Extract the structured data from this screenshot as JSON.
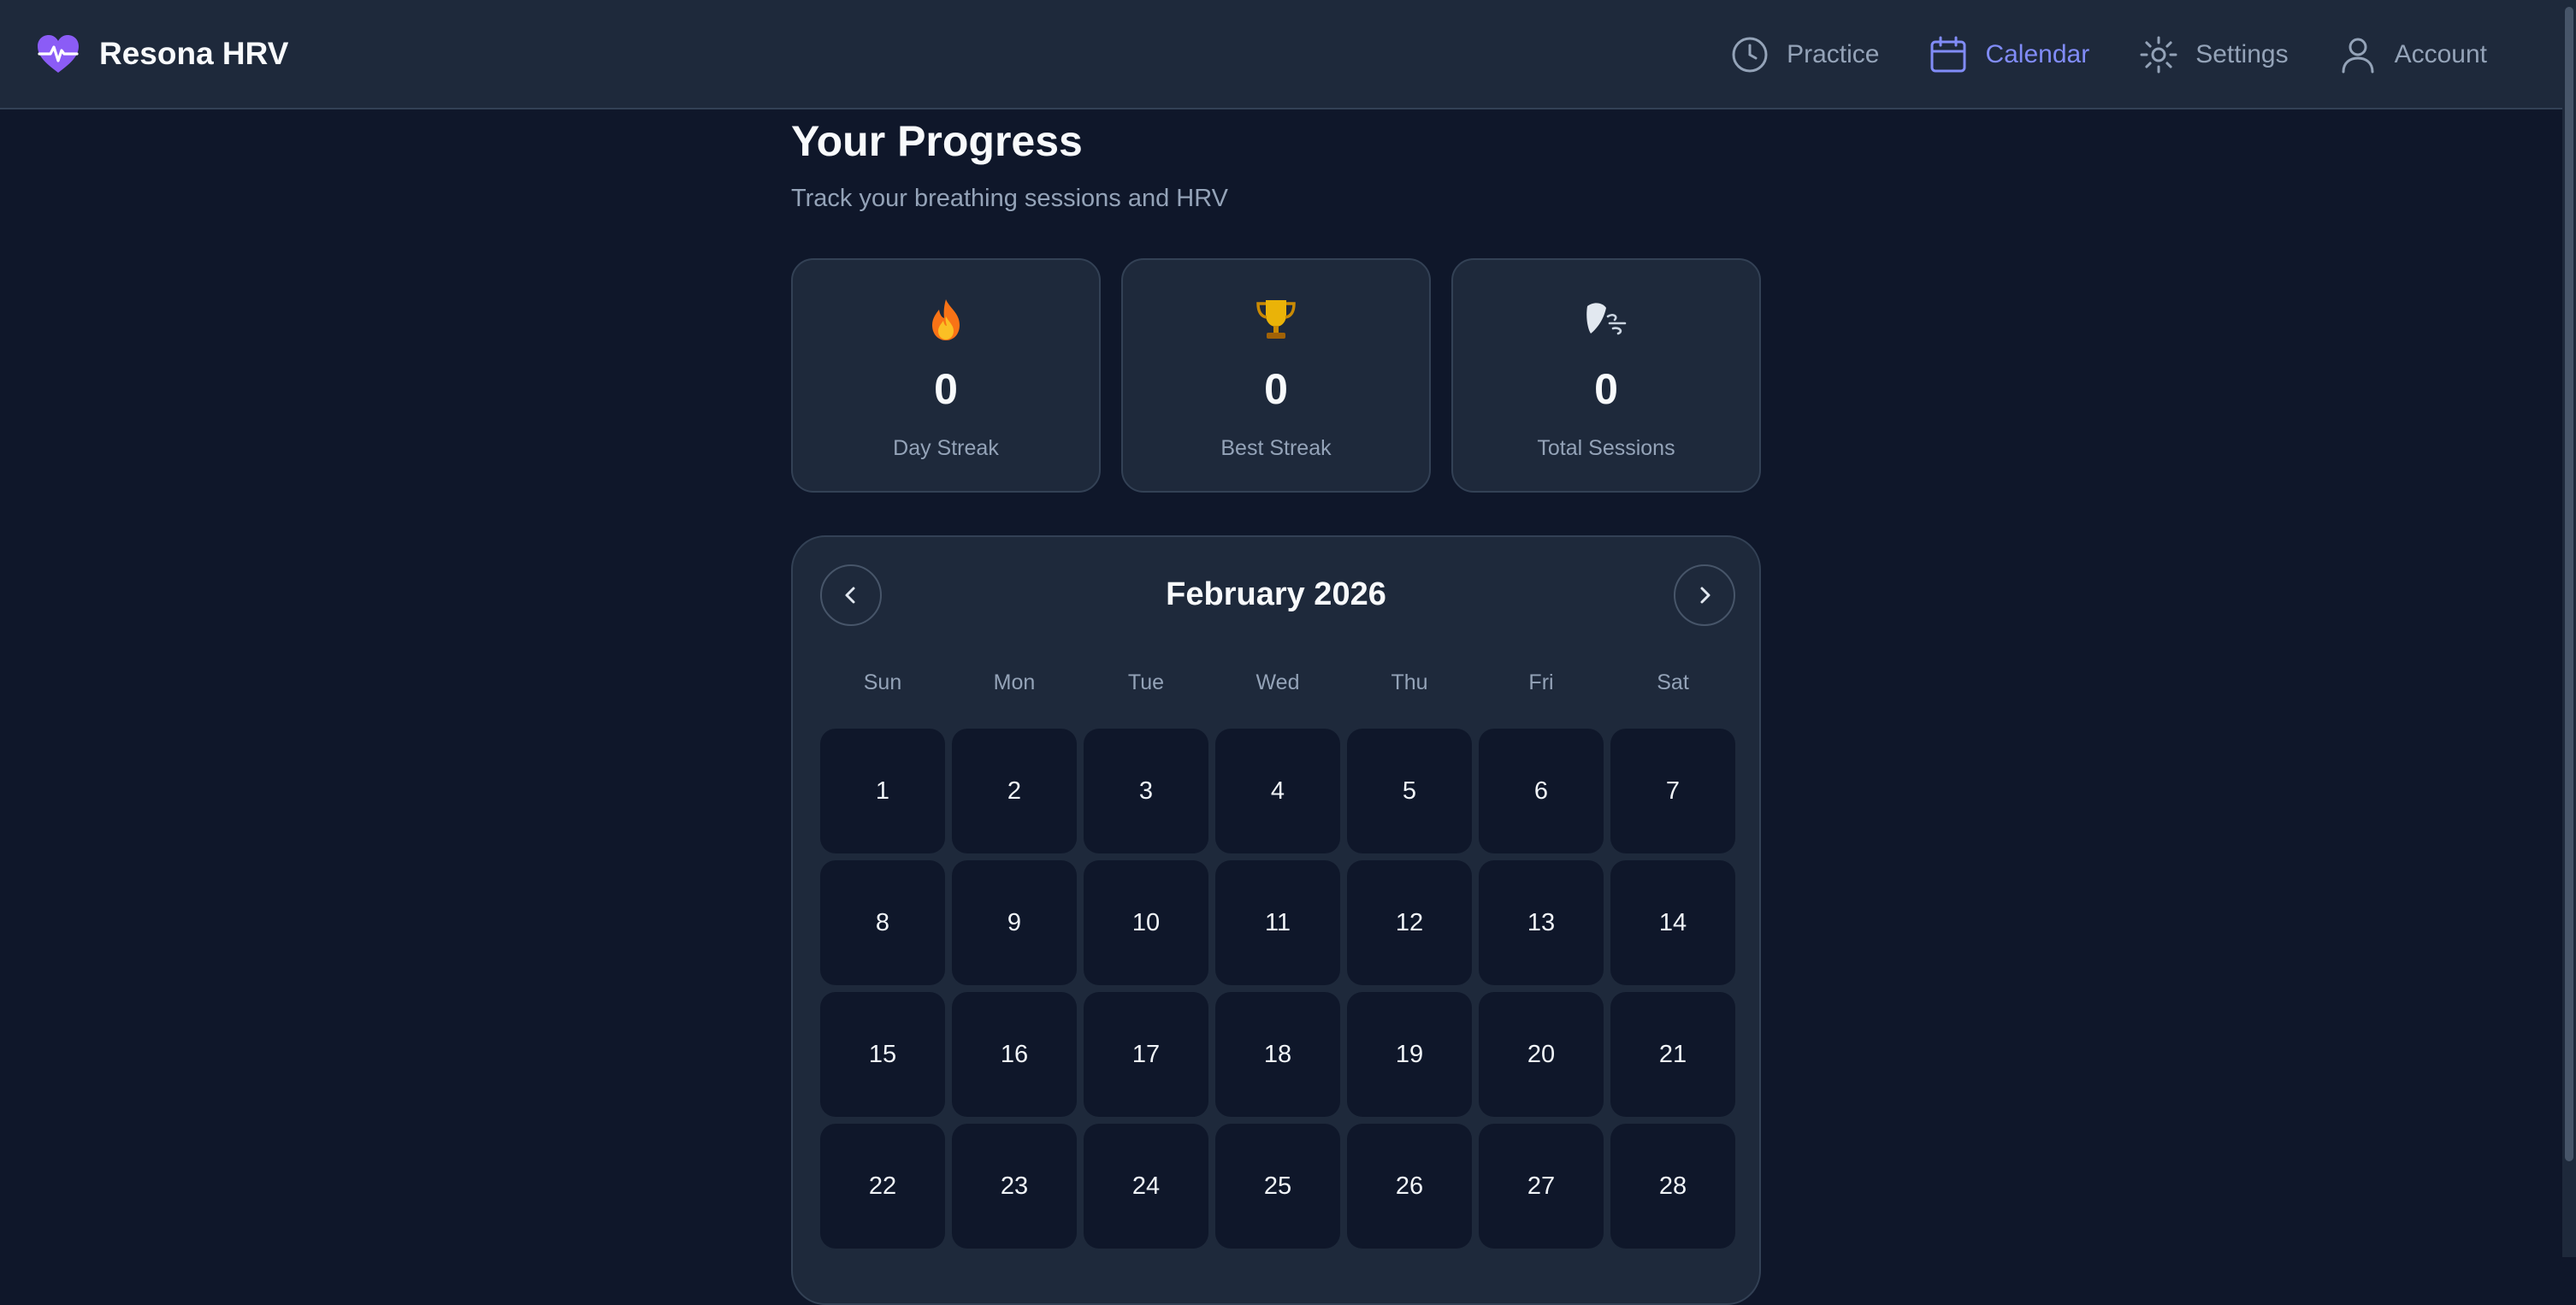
{
  "app": {
    "name": "Resona HRV",
    "accent_color": "#818cf8",
    "logo_color": "#8b5cf6"
  },
  "nav": {
    "items": [
      {
        "label": "Practice",
        "icon": "clock-icon",
        "active": false
      },
      {
        "label": "Calendar",
        "icon": "calendar-icon",
        "active": true
      },
      {
        "label": "Settings",
        "icon": "gear-icon",
        "active": false
      },
      {
        "label": "Account",
        "icon": "user-icon",
        "active": false
      }
    ]
  },
  "page": {
    "title": "Your Progress",
    "subtitle": "Track your breathing sessions and HRV"
  },
  "stats": [
    {
      "icon": "fire-icon",
      "value": "0",
      "label": "Day Streak"
    },
    {
      "icon": "trophy-icon",
      "value": "0",
      "label": "Best Streak"
    },
    {
      "icon": "wind-icon",
      "value": "0",
      "label": "Total Sessions"
    }
  ],
  "calendar": {
    "month_label": "February 2026",
    "prev_icon": "chevron-left-icon",
    "next_icon": "chevron-right-icon",
    "weekdays": [
      "Sun",
      "Mon",
      "Tue",
      "Wed",
      "Thu",
      "Fri",
      "Sat"
    ],
    "days": [
      "1",
      "2",
      "3",
      "4",
      "5",
      "6",
      "7",
      "8",
      "9",
      "10",
      "11",
      "12",
      "13",
      "14",
      "15",
      "16",
      "17",
      "18",
      "19",
      "20",
      "21",
      "22",
      "23",
      "24",
      "25",
      "26",
      "27",
      "28"
    ]
  }
}
